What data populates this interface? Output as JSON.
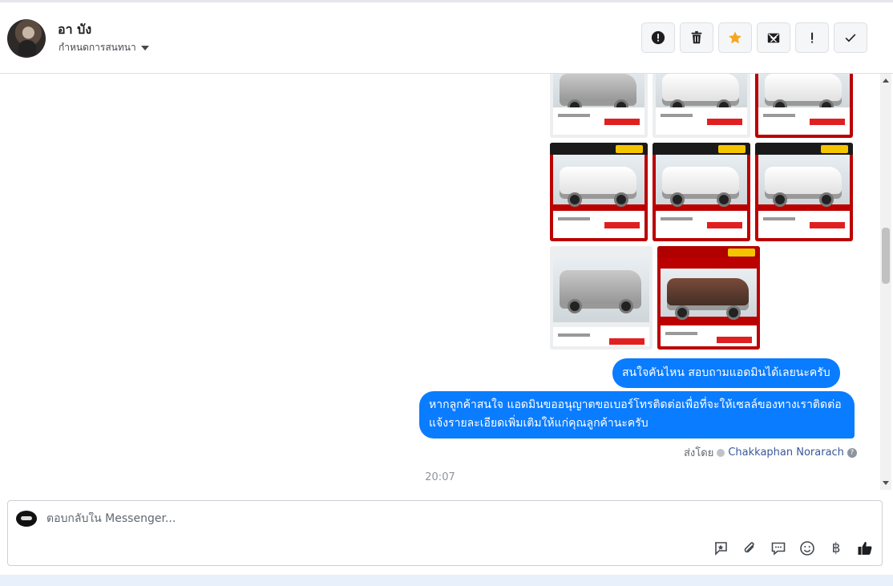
{
  "header": {
    "contact_name": "อา บัง",
    "assign_label": "กำหนดการสนทนา",
    "actions": [
      {
        "name": "report-spam-button",
        "icon": "exclamation-circle-icon"
      },
      {
        "name": "delete-button",
        "icon": "trash-icon"
      },
      {
        "name": "star-button",
        "icon": "star-icon"
      },
      {
        "name": "mark-unread-button",
        "icon": "envelope-x-icon"
      },
      {
        "name": "follow-up-button",
        "icon": "exclamation-icon"
      },
      {
        "name": "mark-done-button",
        "icon": "checkmark-icon"
      }
    ],
    "star_color": "#f5a623"
  },
  "thread": {
    "messages": [
      {
        "text": "สนใจคันไหน สอบถามแอดมินได้เลยนะครับ"
      },
      {
        "text": "หากลูกค้าสนใจ แอดมินขออนุญาตขอเบอร์โทรติดต่อเพื่อที่จะให้เซลล์ของทางเราติดต่อแจ้งรายละเอียดเพิ่มเติมให้แก่คุณลูกค้านะครับ"
      }
    ],
    "sent_by_prefix": "ส่งโดย",
    "sent_by_name": "Chakkaphan Norarach",
    "help_glyph": "?",
    "timestamp": "20:07",
    "bubble_color": "#0a7cff"
  },
  "composer": {
    "placeholder": "ตอบกลับใน Messenger...",
    "baht_glyph": "฿",
    "tools": [
      "saved-reply-icon",
      "attachment-icon",
      "message-icon",
      "emoji-icon",
      "baht-icon",
      "thumbs-up-icon"
    ]
  }
}
